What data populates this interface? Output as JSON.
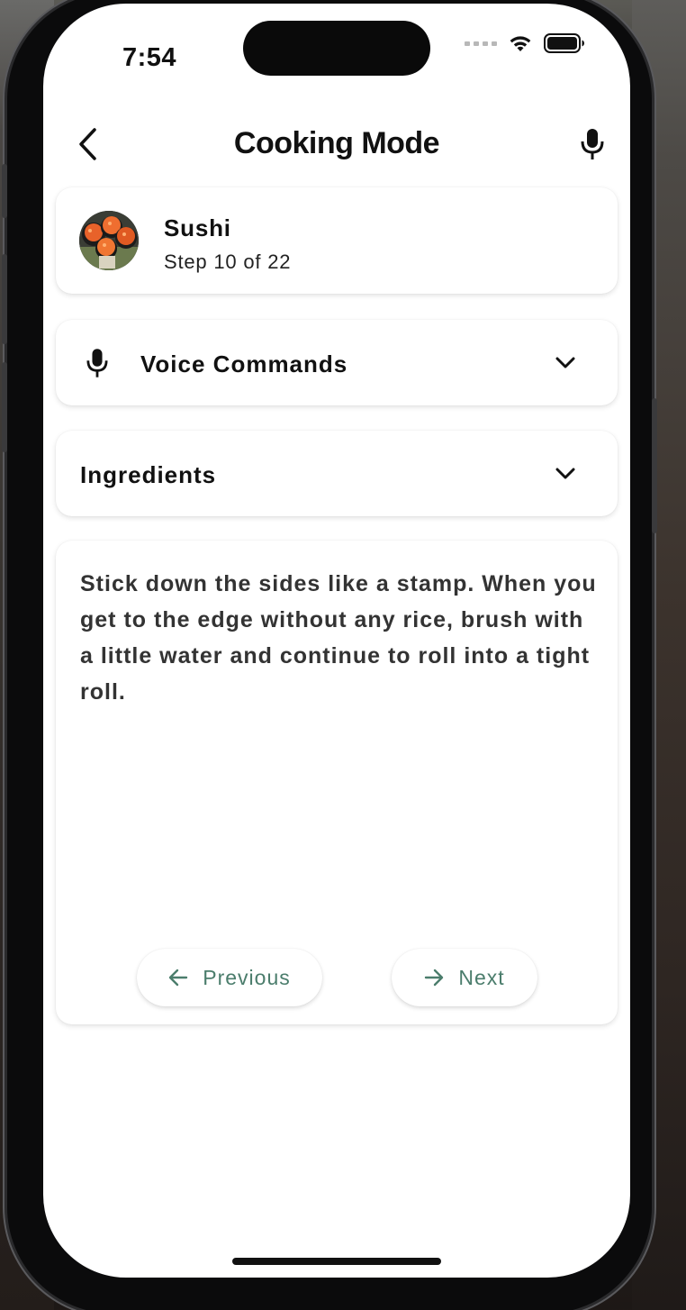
{
  "status_bar": {
    "time": "7:54"
  },
  "nav": {
    "title": "Cooking Mode",
    "back_icon": "chevron-left-icon",
    "mic_icon": "microphone-icon"
  },
  "recipe": {
    "name": "Sushi",
    "step_label": "Step 10 of 22"
  },
  "voice_commands": {
    "label": "Voice Commands",
    "icon": "microphone-icon",
    "expanded": false
  },
  "ingredients": {
    "label": "Ingredients",
    "expanded": false
  },
  "step": {
    "text": "Stick down the sides like a stamp. When you get to the edge without any rice, brush with a little water and continue to roll into a tight roll."
  },
  "controls": {
    "previous_label": "Previous",
    "next_label": "Next"
  },
  "colors": {
    "accent": "#4b7d6c",
    "text": "#111111",
    "card_bg": "#ffffff"
  }
}
